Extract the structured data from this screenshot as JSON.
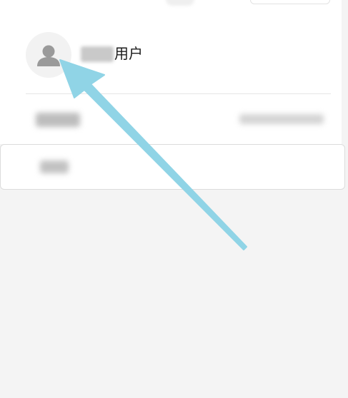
{
  "profile": {
    "avatar_icon": "user-silhouette-icon",
    "name_suffix": "用户"
  },
  "annotation": {
    "arrow_color": "#90d4e6",
    "arrow_icon": "annotation-arrow-icon"
  },
  "colors": {
    "background": "#f4f4f4",
    "card": "#ffffff",
    "divider": "#e6e6e6"
  }
}
